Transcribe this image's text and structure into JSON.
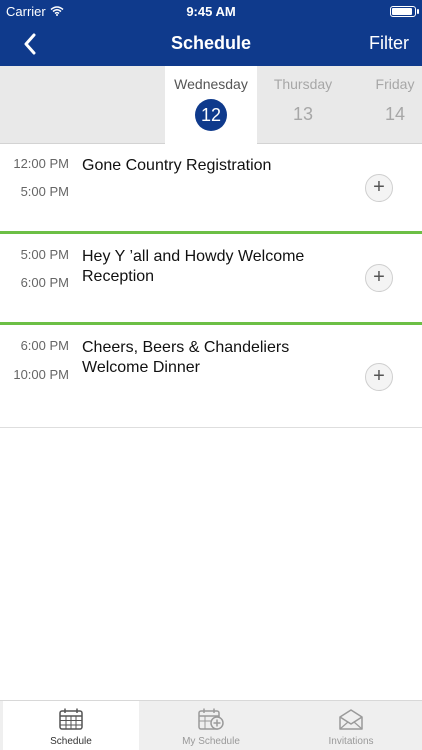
{
  "status_bar": {
    "carrier": "Carrier",
    "time": "9:45 AM"
  },
  "nav": {
    "title": "Schedule",
    "filter_label": "Filter"
  },
  "days": [
    {
      "name": "Wednesday",
      "number": "12",
      "selected": true
    },
    {
      "name": "Thursday",
      "number": "13",
      "selected": false
    },
    {
      "name": "Friday",
      "number": "14",
      "selected": false
    }
  ],
  "events": [
    {
      "start": "12:00 PM",
      "end": "5:00 PM",
      "title": "Gone Country Registration",
      "add_label": "+"
    },
    {
      "start": "5:00 PM",
      "end": "6:00 PM",
      "title": "Hey Y ’all and Howdy Welcome Reception",
      "add_label": "+"
    },
    {
      "start": "6:00 PM",
      "end": "10:00 PM",
      "title": "Cheers, Beers & Chandeliers Welcome Dinner",
      "add_label": "+"
    }
  ],
  "tabs": [
    {
      "label": "Schedule",
      "icon": "calendar-icon",
      "active": true
    },
    {
      "label": "My Schedule",
      "icon": "calendar-add-icon",
      "active": false
    },
    {
      "label": "Invitations",
      "icon": "envelope-icon",
      "active": false
    }
  ],
  "colors": {
    "brand": "#0f3a8c",
    "accent_line": "#6cbf45"
  }
}
